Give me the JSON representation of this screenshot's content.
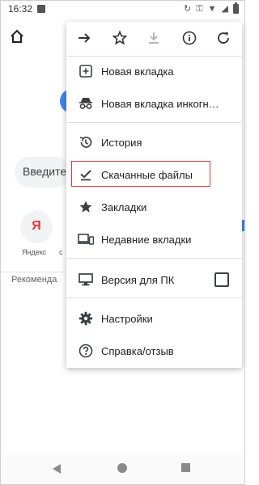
{
  "status_bar": {
    "time": "16:32"
  },
  "background": {
    "search_placeholder": "Введите",
    "tile_letter": "Я",
    "tile_label": "Яндекс",
    "tile_label_2": "с",
    "tile_label_3": "к",
    "recommended_label": "Рекоменда"
  },
  "menu": {
    "toolbar": {
      "forward": "→",
      "bookmark": "☆",
      "download": "↓",
      "info": "ⓘ",
      "refresh": "↻"
    },
    "items": [
      {
        "label": "Новая вкладка",
        "icon": "new-tab-icon"
      },
      {
        "label": "Новая вкладка инкогн…",
        "icon": "incognito-icon"
      },
      {
        "label": "История",
        "icon": "history-icon"
      },
      {
        "label": "Скачанные файлы",
        "icon": "downloads-check-icon"
      },
      {
        "label": "Закладки",
        "icon": "star-icon"
      },
      {
        "label": "Недавние вкладки",
        "icon": "devices-icon"
      },
      {
        "label": "Версия для ПК",
        "icon": "desktop-icon"
      },
      {
        "label": "Настройки",
        "icon": "gear-icon"
      },
      {
        "label": "Справка/отзыв",
        "icon": "help-icon"
      }
    ]
  },
  "colors": {
    "highlight": "#e53935",
    "accent": "#4285f4"
  }
}
